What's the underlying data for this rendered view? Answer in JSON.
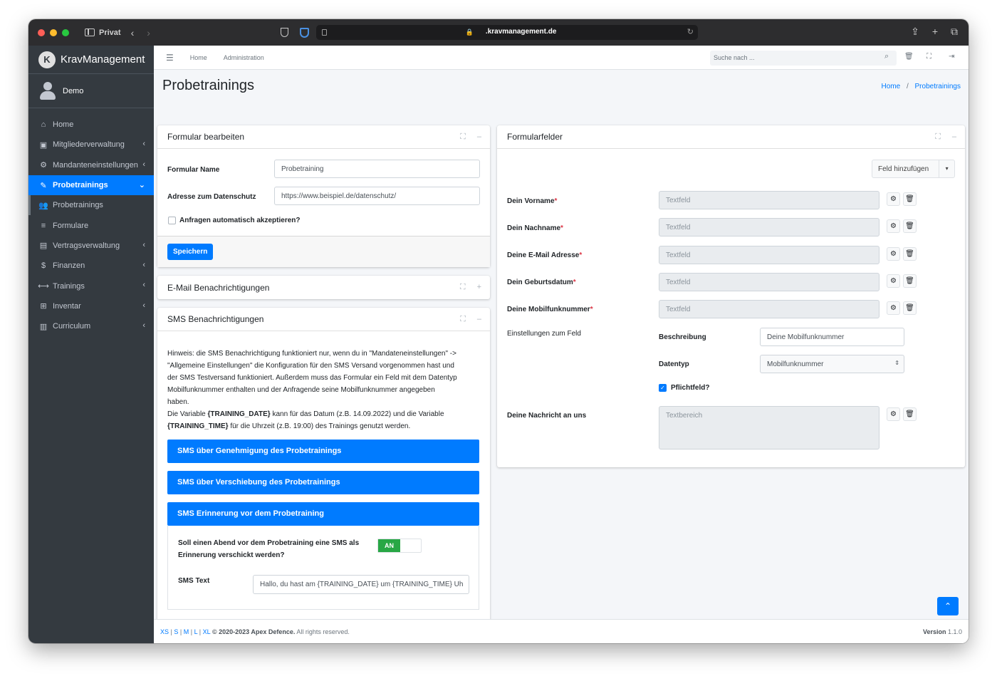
{
  "browser": {
    "mode_label": "Privat",
    "url": ".kravmanagement.de"
  },
  "brand": {
    "logo_letter": "K",
    "name": "KravManagement"
  },
  "user": {
    "name": "Demo"
  },
  "sidebar": {
    "items": [
      {
        "label": "Home",
        "icon": "home-icon",
        "glyph": "⌂"
      },
      {
        "label": "Mitgliederverwaltung",
        "icon": "id-card-icon",
        "glyph": "▣"
      },
      {
        "label": "Mandanteneinstellungen",
        "icon": "cogs-icon",
        "glyph": "⚙"
      },
      {
        "label": "Probetrainings",
        "icon": "pencil-icon",
        "glyph": "✎"
      },
      {
        "label": "Probetrainings",
        "icon": "users-icon",
        "glyph": "👥"
      },
      {
        "label": "Formulare",
        "icon": "list-icon",
        "glyph": "≡"
      },
      {
        "label": "Vertragsverwaltung",
        "icon": "file-icon",
        "glyph": "▤"
      },
      {
        "label": "Finanzen",
        "icon": "hand-coin-icon",
        "glyph": "$"
      },
      {
        "label": "Trainings",
        "icon": "dumbbell-icon",
        "glyph": "⟷"
      },
      {
        "label": "Inventar",
        "icon": "pallet-icon",
        "glyph": "⊞"
      },
      {
        "label": "Curriculum",
        "icon": "book-icon",
        "glyph": "▥"
      }
    ]
  },
  "topnav": {
    "home": "Home",
    "administration": "Administration",
    "search_placeholder": "Suche nach ..."
  },
  "page": {
    "title": "Probetrainings",
    "breadcrumb_home": "Home",
    "breadcrumb_sep": "/",
    "breadcrumb_current": "Probetrainings"
  },
  "form_edit": {
    "title": "Formular bearbeiten",
    "name_label": "Formular Name",
    "name_value": "Probetraining",
    "privacy_label": "Adresse zum Datenschutz",
    "privacy_value": "https://www.beispiel.de/datenschutz/",
    "auto_accept_label": "Anfragen automatisch akzeptieren?",
    "save_label": "Speichern"
  },
  "email_card": {
    "title": "E-Mail Benachrichtigungen"
  },
  "sms_card": {
    "title": "SMS Benachrichtigungen",
    "hint_line1": "Hinweis: die SMS Benachrichtigung funktioniert nur, wenn du in \"Mandateneinstellungen\" ->",
    "hint_line2": "\"Allgemeine Einstellungen\" die Konfiguration für den SMS Versand vorgenommen hast und",
    "hint_line3": "der SMS Testversand funktioniert. Außerdem muss das Formular ein Feld mit dem Datentyp",
    "hint_line4": "Mobilfunknummer enthalten und der Anfragende seine Mobilfunknummer angegeben",
    "hint_line5": "haben.",
    "hint_line6_a": "Die Variable ",
    "hint_line6_var": "{TRAINING_DATE}",
    "hint_line6_b": " kann für das Datum (z.B. 14.09.2022) und die Variable",
    "hint_line7_var": "{TRAINING_TIME}",
    "hint_line7_b": " für die Uhrzeit (z.B. 19:00) des Trainings genutzt werden.",
    "bar1": "SMS über Genehmigung des Probetrainings",
    "bar2": "SMS über Verschiebung des Probetrainings",
    "bar3": "SMS Erinnerung vor dem Probetraining",
    "reminder_q_line1": "Soll einen Abend vor dem Probetraining eine SMS als",
    "reminder_q_line2": "Erinnerung verschickt werden?",
    "toggle_label": "AN",
    "sms_text_label": "SMS Text",
    "sms_text_value": "Hallo, du hast am {TRAINING_DATE} um {TRAINING_TIME} Uh"
  },
  "fields_card": {
    "title": "Formularfelder",
    "add_field_label": "Feld hinzufügen",
    "fields": [
      {
        "label": "Dein Vorname",
        "required_mark": "*",
        "type": "Textfeld"
      },
      {
        "label": "Dein Nachname",
        "required_mark": "*",
        "type": "Textfeld"
      },
      {
        "label": "Deine E-Mail Adresse",
        "required_mark": "*",
        "type": "Textfeld"
      },
      {
        "label": "Dein Geburtsdatum",
        "required_mark": "*",
        "type": "Textfeld"
      },
      {
        "label": "Deine Mobilfunknummer",
        "required_mark": "*",
        "type": "Textfeld"
      }
    ],
    "settings_label": "Einstellungen zum Feld",
    "desc_label": "Beschreibung",
    "desc_value": "Deine Mobilfunknummer",
    "datatype_label": "Datentyp",
    "datatype_value": "Mobilfunknummer",
    "required_label": "Pflichtfeld?",
    "message_label": "Deine Nachricht an uns",
    "message_type": "Textbereich"
  },
  "footer": {
    "sizes": [
      "XS",
      "S",
      "M",
      "L",
      "XL"
    ],
    "copyright_bold": "© 2020-2023 Apex Defence.",
    "copyright_rest": " All rights reserved.",
    "version_label": "Version",
    "version_value": "1.1.0"
  },
  "colors": {
    "primary": "#007bff",
    "sidebar": "#343a40",
    "success": "#28a745",
    "danger": "#dc3545"
  }
}
